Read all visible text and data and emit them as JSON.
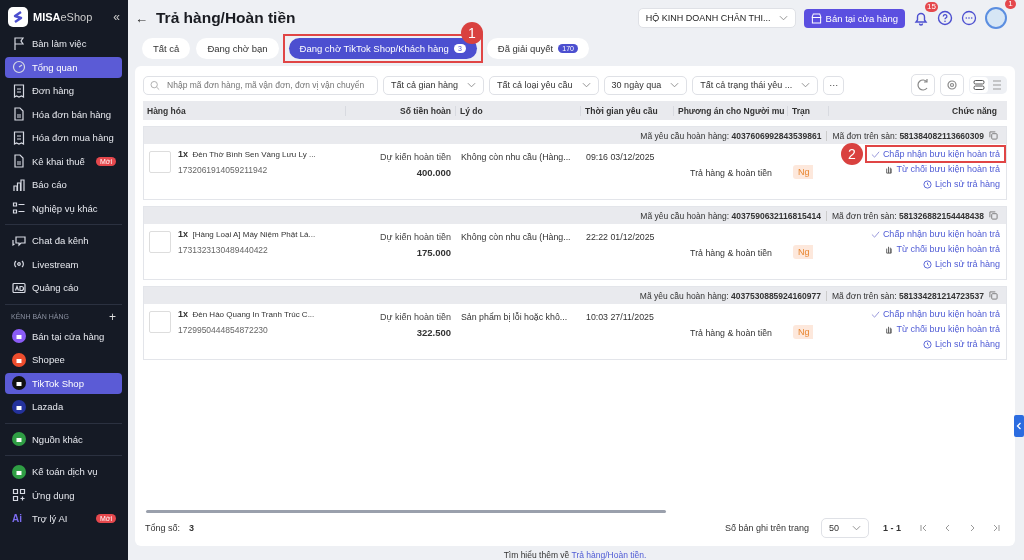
{
  "sidebar": {
    "logo": {
      "brand": "MISA",
      "product": "eShop"
    },
    "collapse": "«",
    "groups": [
      {
        "items": [
          {
            "label": "Bàn làm việc",
            "selected": false
          },
          {
            "label": "Tổng quan",
            "selected": true
          },
          {
            "label": "Đơn hàng",
            "selected": false
          },
          {
            "label": "Hóa đơn bán hàng",
            "selected": false
          },
          {
            "label": "Hóa đơn mua hàng",
            "selected": false
          },
          {
            "label": "Kê khai thuế",
            "selected": false,
            "badge": "Mới"
          },
          {
            "label": "Báo cáo",
            "selected": false
          },
          {
            "label": "Nghiệp vụ khác",
            "selected": false
          }
        ]
      },
      {
        "items": [
          {
            "label": "Chat đa kênh",
            "selected": false
          },
          {
            "label": "Livestream",
            "selected": false
          },
          {
            "label": "Quảng cáo",
            "selected": false
          }
        ]
      },
      {
        "heading": "KÊNH BÁN HÀNG",
        "add": "+",
        "items": [
          {
            "label": "Bán tại cửa hàng",
            "selected": false,
            "color": "#8b5cf6"
          },
          {
            "label": "Shopee",
            "selected": false,
            "color": "#ee4d2d"
          },
          {
            "label": "TikTok Shop",
            "selected": true,
            "color": "#111111"
          },
          {
            "label": "Lazada",
            "selected": false,
            "color": "#24329c"
          }
        ]
      },
      {
        "items": [
          {
            "label": "Nguồn khác",
            "selected": false,
            "color": "#2f9e44"
          }
        ]
      },
      {
        "items": [
          {
            "label": "Kế toán dịch vụ",
            "selected": false,
            "color": "#2f9e44"
          },
          {
            "label": "Ứng dụng",
            "selected": false
          },
          {
            "label": "Trợ lý AI",
            "selected": false,
            "badge": "Mới",
            "icon_text": "Ai"
          }
        ]
      }
    ]
  },
  "topbar": {
    "back": "←",
    "title": "Trả hàng/Hoàn tiền",
    "store_select": "HỘ KINH DOANH CHÂN THI...",
    "pos_button": "Bán tại cửa hàng",
    "notifications": "15",
    "avatar_badge": "1"
  },
  "tabs": [
    {
      "label": "Tất cả",
      "selected": false
    },
    {
      "label": "Đang chờ bạn",
      "selected": false
    },
    {
      "label": "Đang chờ TikTok Shop/Khách hàng",
      "selected": true,
      "count": "3",
      "callout": "1"
    },
    {
      "label": "Đã giải quyết",
      "selected": false,
      "count": "170"
    }
  ],
  "filters": {
    "search": {
      "placeholder": "Nhập mã đơn hàng, mã vận đơn, đơn vị vận chuyển"
    },
    "dropdowns": [
      "Tất cả gian hàng",
      "Tất cả loại yêu cầu",
      "30 ngày qua",
      "Tất cả trạng thái yêu ..."
    ],
    "more": "···"
  },
  "table": {
    "columns": [
      "Hàng hóa",
      "Số tiền hoàn",
      "Lý do",
      "Thời gian yêu cầu",
      "Phương án cho Người mu",
      "Trạn",
      "Chức năng"
    ],
    "rows": [
      {
        "request_label": "Mã yêu cầu hoàn hàng:",
        "request_code": "4037606992843539861",
        "order_label": "Mã đơn trên sàn:",
        "order_code": "581384082113660309",
        "qty": "1x",
        "product": "Đèn Thờ Bình Sen Vàng Lưu Ly ...",
        "sku": "1732061914059211942",
        "refund_label": "Dự kiến hoàn tiền",
        "amount": "400.000",
        "reason": "Không còn nhu cầu (Hàng...",
        "time": "09:16 03/12/2025",
        "solution": "Trả hàng & hoàn tiền",
        "status": "Ng",
        "actions": [
          {
            "label": "Chấp nhận bưu kiện hoàn trả",
            "callout": "2"
          },
          {
            "label": "Từ chối bưu kiện hoàn trả"
          },
          {
            "label": "Lịch sử trả hàng"
          }
        ]
      },
      {
        "request_label": "Mã yêu cầu hoàn hàng:",
        "request_code": "4037590632116815414",
        "order_label": "Mã đơn trên sàn:",
        "order_code": "581326882154448438",
        "qty": "1x",
        "product": "[Hàng Loại A] Máy Niệm Phật Lá...",
        "sku": "1731323130489440422",
        "refund_label": "Dự kiến hoàn tiền",
        "amount": "175.000",
        "reason": "Không còn nhu cầu (Hàng...",
        "time": "22:22 01/12/2025",
        "solution": "Trả hàng & hoàn tiền",
        "status": "Ng",
        "actions": [
          {
            "label": "Chấp nhận bưu kiện hoàn trả"
          },
          {
            "label": "Từ chối bưu kiện hoàn trả"
          },
          {
            "label": "Lịch sử trả hàng"
          }
        ]
      },
      {
        "request_label": "Mã yêu cầu hoàn hàng:",
        "request_code": "4037530885924160977",
        "order_label": "Mã đơn trên sàn:",
        "order_code": "581334281214723537",
        "qty": "1x",
        "product": "Đèn Hào Quang In Tranh Trúc C...",
        "sku": "1729950444854872230",
        "refund_label": "Dự kiến hoàn tiền",
        "amount": "322.500",
        "reason": "Sản phẩm bị lỗi hoặc khô...",
        "time": "10:03 27/11/2025",
        "solution": "Trả hàng & hoàn tiền",
        "status": "Ng",
        "actions": [
          {
            "label": "Chấp nhận bưu kiện hoàn trả"
          },
          {
            "label": "Từ chối bưu kiện hoàn trả"
          },
          {
            "label": "Lịch sử trả hàng"
          }
        ]
      }
    ]
  },
  "footer": {
    "total_label": "Tổng số:",
    "total": "3",
    "page_size_label": "Số bản ghi trên trang",
    "page_size": "50",
    "range": "1 - 1"
  },
  "help": {
    "text": "Tìm hiểu thêm về",
    "link": "Trả hàng/Hoàn tiền."
  }
}
